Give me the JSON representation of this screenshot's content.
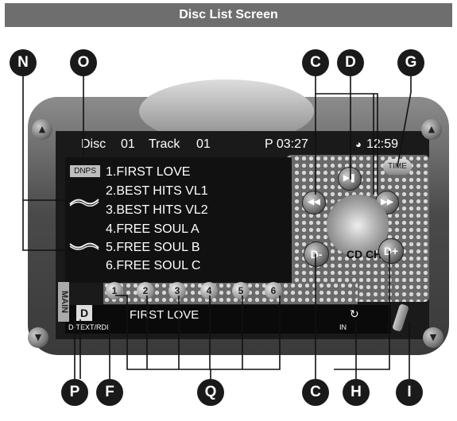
{
  "title": "Disc List Screen",
  "status_bar": {
    "disc_label": "Disc",
    "disc": "01",
    "track_label": "Track",
    "track": "01",
    "play_time": "P 03:27",
    "clock": "12:59"
  },
  "dnps_badge": "DNPS",
  "tracks": [
    "1.FIRST LOVE",
    "2.BEST HITS VL1",
    "3.BEST HITS VL2",
    "4.FREE SOUL A",
    "5.FREE SOUL B",
    "6.FREE SOUL C"
  ],
  "disc_buttons": [
    "1",
    "2",
    "3",
    "4",
    "5",
    "6"
  ],
  "time_button": "TIME",
  "cd_ch_label": "CD CH",
  "d_minus": "D-",
  "d_plus": "D+",
  "main_tab": "MAIN",
  "info_bar": {
    "d_icon": "D",
    "title": "FIRST LOVE",
    "text_mode": "D-TEXT/RDI",
    "mode_label": "IN"
  },
  "callouts": {
    "n": "N",
    "o": "O",
    "c": "C",
    "d": "D",
    "g": "G",
    "p": "P",
    "f": "F",
    "q": "Q",
    "h": "H",
    "i": "I"
  },
  "icons": {
    "prev": "skip-back-icon",
    "play_pause": "play-pause-icon",
    "next": "skip-forward-icon",
    "scroll_up": "up-arrow-icon",
    "scroll_down": "down-arrow-icon",
    "repeat": "repeat-icon",
    "edit": "pencil-icon"
  }
}
